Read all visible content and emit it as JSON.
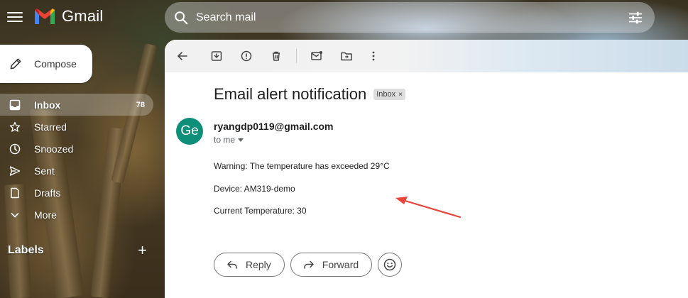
{
  "app": {
    "name": "Gmail"
  },
  "search": {
    "placeholder": "Search mail"
  },
  "compose": {
    "label": "Compose"
  },
  "sidebar": {
    "items": [
      {
        "label": "Inbox",
        "count": "78",
        "icon": "inbox-icon",
        "active": true
      },
      {
        "label": "Starred",
        "icon": "star-icon"
      },
      {
        "label": "Snoozed",
        "icon": "clock-icon"
      },
      {
        "label": "Sent",
        "icon": "send-icon"
      },
      {
        "label": "Drafts",
        "icon": "draft-icon"
      },
      {
        "label": "More",
        "icon": "chevron-down-icon"
      }
    ],
    "labels_heading": "Labels"
  },
  "email": {
    "subject": "Email alert notification",
    "tag": "Inbox",
    "avatar_initials": "Ge",
    "avatar_color": "#0e8f7a",
    "sender": "ryangdp0119@gmail.com",
    "to": "to me",
    "body": [
      "Warning: The temperature has exceeded 29°C",
      "Device: AM319-demo",
      "Current Temperature: 30"
    ]
  },
  "actions": {
    "reply": "Reply",
    "forward": "Forward"
  },
  "colors": {
    "annotation_arrow": "#e8453c"
  }
}
